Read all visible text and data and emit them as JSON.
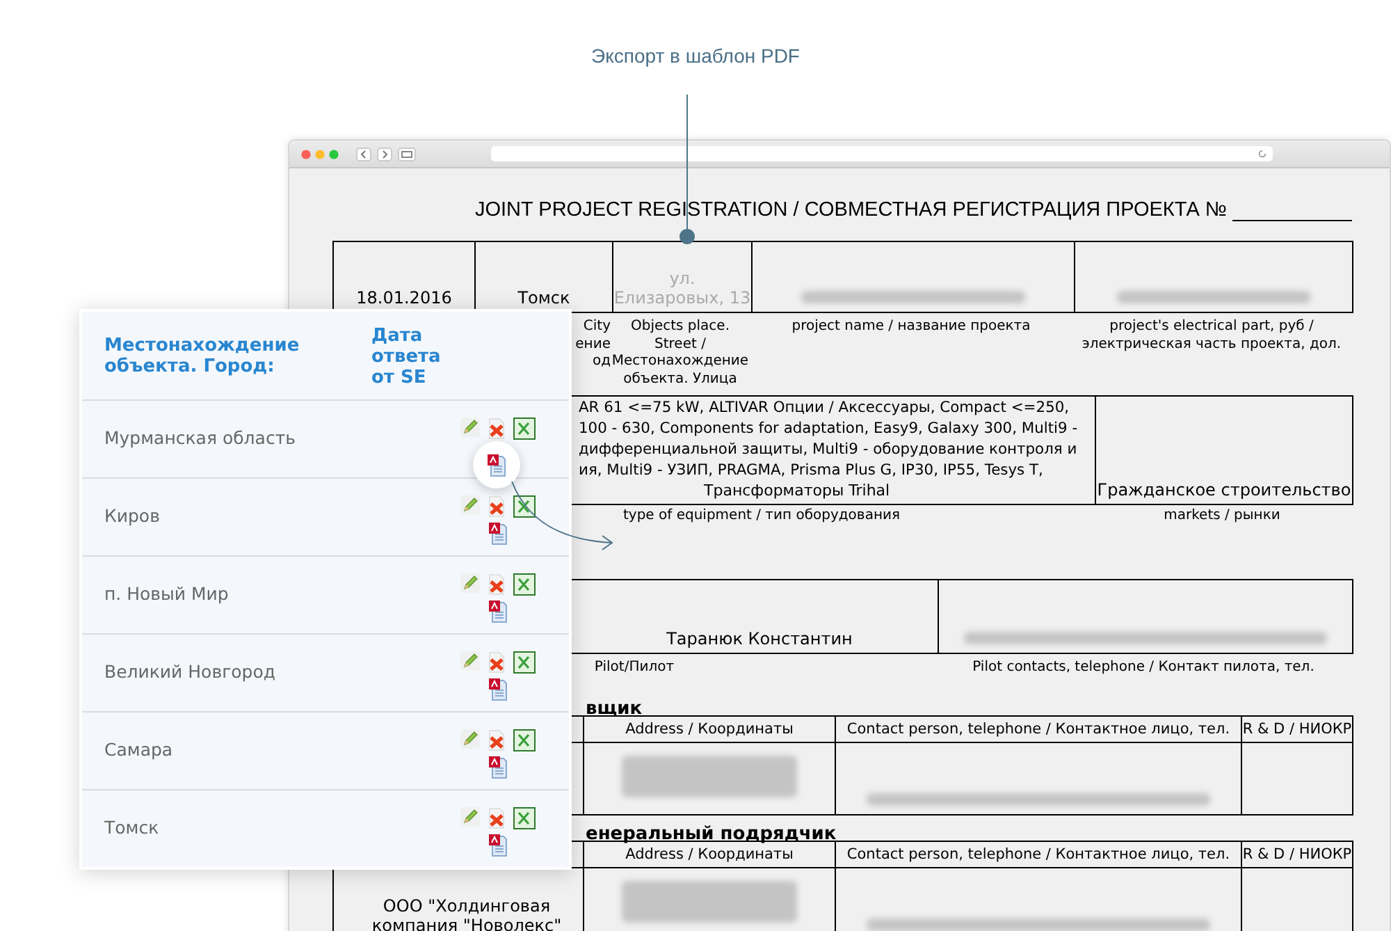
{
  "callout": {
    "label": "Экспорт в шаблон PDF"
  },
  "document": {
    "title": "JOINT PROJECT REGISTRATION / СОВМЕСТНАЯ РЕГИСТРАЦИЯ ПРОЕКТА №",
    "project_table": {
      "cells": [
        {
          "kind": "text",
          "text": "18.01.2016"
        },
        {
          "kind": "text",
          "text": "Томск"
        },
        {
          "kind": "faded",
          "text": "ул. Елизаровых, 13"
        },
        {
          "kind": "blurred"
        },
        {
          "kind": "blurred"
        }
      ],
      "labels": [
        [
          "City",
          "ение",
          "од"
        ],
        [
          "Objects place.",
          "Street /",
          "Местонахождение",
          "объекта. Улица"
        ],
        [
          "project name / название проекта"
        ],
        [
          "project's electrical part, руб /",
          "электрическая часть проекта, дол."
        ]
      ]
    },
    "equipment_table": {
      "equipment_lines": [
        "AR 61 <=75 kW, ALTIVAR Опции / Аксессуары, Compact <=250,",
        "100 - 630, Components for adaptation, Easy9, Galaxy 300, Multi9 -",
        "дифференциальной защиты, Multi9 - оборудование контроля и",
        "ия, Multi9 - УЗИП, PRAGMA, Prisma Plus G, IP30, IP55, Tesys T,"
      ],
      "equipment_last_line": "Трансформаторы Trihal",
      "market": "Гражданское строительство",
      "labels": [
        "type of equipment / тип оборудования",
        "markets / рынки"
      ]
    },
    "pilot_table": {
      "pilot": "Таранюк Константин",
      "labels": [
        "Pilot/Пилот",
        "Pilot contacts, telephone / Контакт пилота, тел."
      ]
    },
    "sections": [
      {
        "heading": "вщик",
        "columns": [
          "Address / Координаты",
          "Contact person, telephone / Контактное лицо, тел.",
          "R & D / НИОКР"
        ]
      },
      {
        "heading": "енеральный подрядчик",
        "columns": [
          "Address / Координаты",
          "Contact person, telephone / Контактное лицо, тел.",
          "R & D / НИОКР"
        ],
        "company": "ООО \"Холдинговая компания \"Новолекс\""
      }
    ]
  },
  "panel": {
    "columns": [
      "Местонахождение объекта. Город:",
      "Дата ответа от SE"
    ],
    "rows": [
      {
        "city": "Мурманская область",
        "highlighted": true
      },
      {
        "city": "Киров",
        "highlighted": false
      },
      {
        "city": "п. Новый Мир",
        "highlighted": false
      },
      {
        "city": "Великий Новгород",
        "highlighted": false
      },
      {
        "city": "Самара",
        "highlighted": false
      },
      {
        "city": "Томск",
        "highlighted": false
      }
    ]
  }
}
